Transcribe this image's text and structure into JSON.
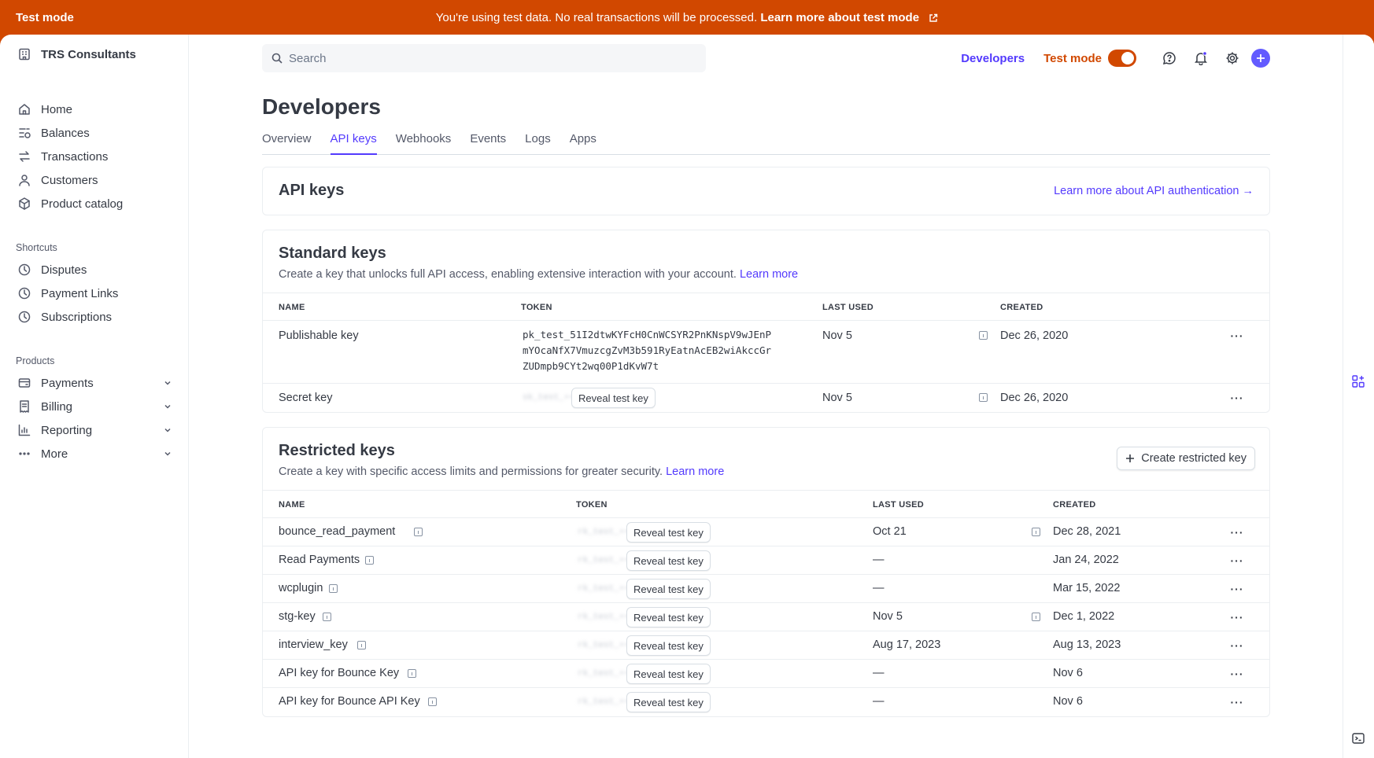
{
  "banner": {
    "label": "Test mode",
    "message": "You're using test data. No real transactions will be processed.",
    "link": "Learn more about test mode"
  },
  "sidebar": {
    "account": "TRS Consultants",
    "main": [
      {
        "label": "Home",
        "icon": "home-icon"
      },
      {
        "label": "Balances",
        "icon": "balances-icon"
      },
      {
        "label": "Transactions",
        "icon": "transactions-icon"
      },
      {
        "label": "Customers",
        "icon": "customers-icon"
      },
      {
        "label": "Product catalog",
        "icon": "product-icon"
      }
    ],
    "shortcuts_label": "Shortcuts",
    "shortcuts": [
      {
        "label": "Disputes",
        "icon": "clock-icon"
      },
      {
        "label": "Payment Links",
        "icon": "clock-icon"
      },
      {
        "label": "Subscriptions",
        "icon": "clock-icon"
      }
    ],
    "products_label": "Products",
    "products": [
      {
        "label": "Payments",
        "icon": "payments-icon"
      },
      {
        "label": "Billing",
        "icon": "billing-icon"
      },
      {
        "label": "Reporting",
        "icon": "reporting-icon"
      },
      {
        "label": "More",
        "icon": "more-icon"
      }
    ]
  },
  "header": {
    "search_placeholder": "Search",
    "developers_link": "Developers",
    "test_mode_label": "Test mode",
    "test_mode_on": true
  },
  "page": {
    "title": "Developers",
    "tabs": [
      "Overview",
      "API keys",
      "Webhooks",
      "Events",
      "Logs",
      "Apps"
    ],
    "active_tab": "API keys"
  },
  "api_keys_card": {
    "title": "API keys",
    "link": "Learn more about API authentication →"
  },
  "standard": {
    "title": "Standard keys",
    "description": "Create a key that unlocks full API access, enabling extensive interaction with your account.",
    "learn_more": "Learn more",
    "columns": [
      "NAME",
      "TOKEN",
      "LAST USED",
      "CREATED"
    ],
    "rows": [
      {
        "name": "Publishable key",
        "token_lines": [
          "pk_test_51I2dtwKYFcH0CnWCSYR2PnKNspV9wJEnP",
          "mYOcaNfX7VmuzcgZvM3b591RyEatnAcEB2wiAkccGr",
          "ZUDmpb9CYt2wq00P1dKvW7t"
        ],
        "last_used": "Nov 5",
        "created": "Dec 26, 2020"
      },
      {
        "name": "Secret key",
        "token_hidden": "sk_test_••••••••••••••••",
        "reveal": "Reveal test key",
        "last_used": "Nov 5",
        "created": "Dec 26, 2020"
      }
    ]
  },
  "restricted": {
    "title": "Restricted keys",
    "description": "Create a key with specific access limits and permissions for greater security.",
    "learn_more": "Learn more",
    "create_button": "Create restricted key",
    "columns": [
      "NAME",
      "TOKEN",
      "LAST USED",
      "CREATED"
    ],
    "reveal": "Reveal test key",
    "token_hidden": "rk_test_••••••••••••••••",
    "rows": [
      {
        "name": "bounce_read_payment",
        "last_used": "Oct 21",
        "created": "Dec 28, 2021",
        "info": true
      },
      {
        "name": "Read Payments",
        "last_used": "—",
        "created": "Jan 24, 2022",
        "info": false
      },
      {
        "name": "wcplugin",
        "last_used": "—",
        "created": "Mar 15, 2022",
        "info": false
      },
      {
        "name": "stg-key",
        "last_used": "Nov 5",
        "created": "Dec 1, 2022",
        "info": true
      },
      {
        "name": "interview_key",
        "last_used": "Aug 17, 2023",
        "created": "Aug 13, 2023",
        "info": false
      },
      {
        "name": "API key for Bounce Key",
        "last_used": "—",
        "created": "Nov 6",
        "info": false
      },
      {
        "name": "API key for Bounce API Key",
        "last_used": "—",
        "created": "Nov 6",
        "info": false
      }
    ]
  },
  "colors": {
    "accent": "#533afd",
    "test_mode": "#d14800"
  }
}
